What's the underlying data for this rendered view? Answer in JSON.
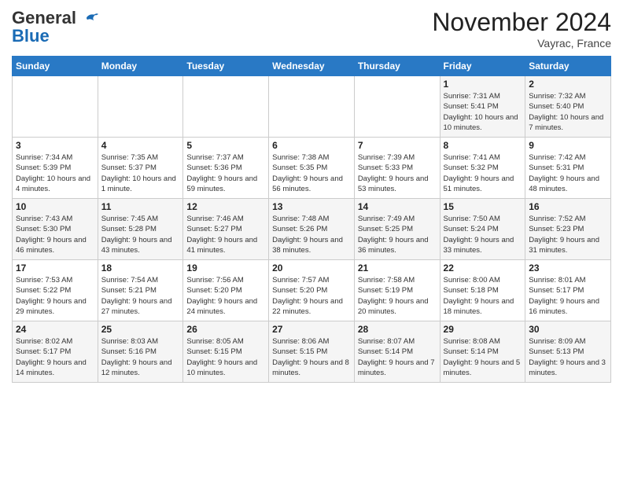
{
  "header": {
    "logo_line1": "General",
    "logo_line2": "Blue",
    "month": "November 2024",
    "location": "Vayrac, France"
  },
  "weekdays": [
    "Sunday",
    "Monday",
    "Tuesday",
    "Wednesday",
    "Thursday",
    "Friday",
    "Saturday"
  ],
  "weeks": [
    [
      {
        "day": "",
        "info": ""
      },
      {
        "day": "",
        "info": ""
      },
      {
        "day": "",
        "info": ""
      },
      {
        "day": "",
        "info": ""
      },
      {
        "day": "",
        "info": ""
      },
      {
        "day": "1",
        "info": "Sunrise: 7:31 AM\nSunset: 5:41 PM\nDaylight: 10 hours and 10 minutes."
      },
      {
        "day": "2",
        "info": "Sunrise: 7:32 AM\nSunset: 5:40 PM\nDaylight: 10 hours and 7 minutes."
      }
    ],
    [
      {
        "day": "3",
        "info": "Sunrise: 7:34 AM\nSunset: 5:39 PM\nDaylight: 10 hours and 4 minutes."
      },
      {
        "day": "4",
        "info": "Sunrise: 7:35 AM\nSunset: 5:37 PM\nDaylight: 10 hours and 1 minute."
      },
      {
        "day": "5",
        "info": "Sunrise: 7:37 AM\nSunset: 5:36 PM\nDaylight: 9 hours and 59 minutes."
      },
      {
        "day": "6",
        "info": "Sunrise: 7:38 AM\nSunset: 5:35 PM\nDaylight: 9 hours and 56 minutes."
      },
      {
        "day": "7",
        "info": "Sunrise: 7:39 AM\nSunset: 5:33 PM\nDaylight: 9 hours and 53 minutes."
      },
      {
        "day": "8",
        "info": "Sunrise: 7:41 AM\nSunset: 5:32 PM\nDaylight: 9 hours and 51 minutes."
      },
      {
        "day": "9",
        "info": "Sunrise: 7:42 AM\nSunset: 5:31 PM\nDaylight: 9 hours and 48 minutes."
      }
    ],
    [
      {
        "day": "10",
        "info": "Sunrise: 7:43 AM\nSunset: 5:30 PM\nDaylight: 9 hours and 46 minutes."
      },
      {
        "day": "11",
        "info": "Sunrise: 7:45 AM\nSunset: 5:28 PM\nDaylight: 9 hours and 43 minutes."
      },
      {
        "day": "12",
        "info": "Sunrise: 7:46 AM\nSunset: 5:27 PM\nDaylight: 9 hours and 41 minutes."
      },
      {
        "day": "13",
        "info": "Sunrise: 7:48 AM\nSunset: 5:26 PM\nDaylight: 9 hours and 38 minutes."
      },
      {
        "day": "14",
        "info": "Sunrise: 7:49 AM\nSunset: 5:25 PM\nDaylight: 9 hours and 36 minutes."
      },
      {
        "day": "15",
        "info": "Sunrise: 7:50 AM\nSunset: 5:24 PM\nDaylight: 9 hours and 33 minutes."
      },
      {
        "day": "16",
        "info": "Sunrise: 7:52 AM\nSunset: 5:23 PM\nDaylight: 9 hours and 31 minutes."
      }
    ],
    [
      {
        "day": "17",
        "info": "Sunrise: 7:53 AM\nSunset: 5:22 PM\nDaylight: 9 hours and 29 minutes."
      },
      {
        "day": "18",
        "info": "Sunrise: 7:54 AM\nSunset: 5:21 PM\nDaylight: 9 hours and 27 minutes."
      },
      {
        "day": "19",
        "info": "Sunrise: 7:56 AM\nSunset: 5:20 PM\nDaylight: 9 hours and 24 minutes."
      },
      {
        "day": "20",
        "info": "Sunrise: 7:57 AM\nSunset: 5:20 PM\nDaylight: 9 hours and 22 minutes."
      },
      {
        "day": "21",
        "info": "Sunrise: 7:58 AM\nSunset: 5:19 PM\nDaylight: 9 hours and 20 minutes."
      },
      {
        "day": "22",
        "info": "Sunrise: 8:00 AM\nSunset: 5:18 PM\nDaylight: 9 hours and 18 minutes."
      },
      {
        "day": "23",
        "info": "Sunrise: 8:01 AM\nSunset: 5:17 PM\nDaylight: 9 hours and 16 minutes."
      }
    ],
    [
      {
        "day": "24",
        "info": "Sunrise: 8:02 AM\nSunset: 5:17 PM\nDaylight: 9 hours and 14 minutes."
      },
      {
        "day": "25",
        "info": "Sunrise: 8:03 AM\nSunset: 5:16 PM\nDaylight: 9 hours and 12 minutes."
      },
      {
        "day": "26",
        "info": "Sunrise: 8:05 AM\nSunset: 5:15 PM\nDaylight: 9 hours and 10 minutes."
      },
      {
        "day": "27",
        "info": "Sunrise: 8:06 AM\nSunset: 5:15 PM\nDaylight: 9 hours and 8 minutes."
      },
      {
        "day": "28",
        "info": "Sunrise: 8:07 AM\nSunset: 5:14 PM\nDaylight: 9 hours and 7 minutes."
      },
      {
        "day": "29",
        "info": "Sunrise: 8:08 AM\nSunset: 5:14 PM\nDaylight: 9 hours and 5 minutes."
      },
      {
        "day": "30",
        "info": "Sunrise: 8:09 AM\nSunset: 5:13 PM\nDaylight: 9 hours and 3 minutes."
      }
    ]
  ]
}
